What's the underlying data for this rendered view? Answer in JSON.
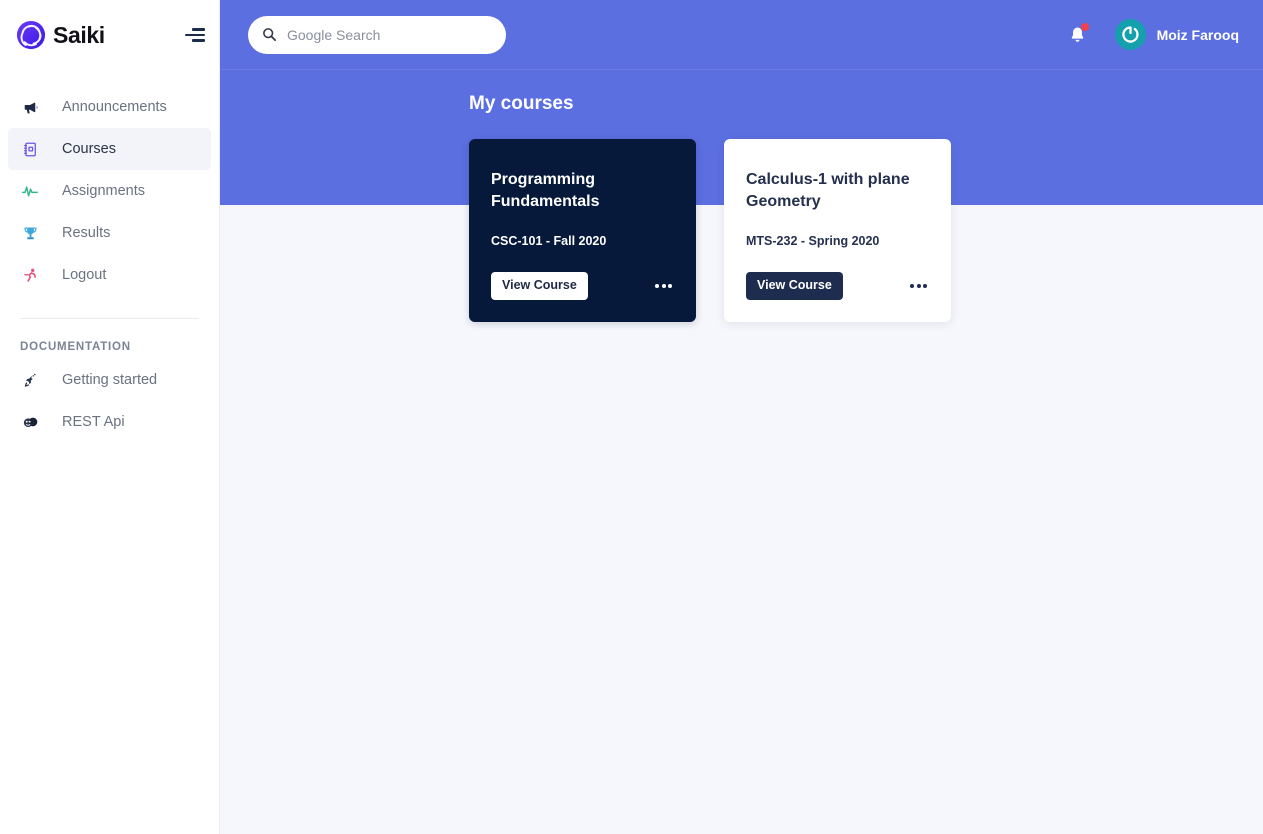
{
  "brand": {
    "name": "Saiki",
    "logo_icon": "aperture-icon",
    "logo_color": "#5522f0",
    "menu_icon": "hamburger-menu-icon"
  },
  "sidebar": {
    "items": [
      {
        "label": "Announcements",
        "icon": "megaphone-icon",
        "active": false
      },
      {
        "label": "Courses",
        "icon": "notebook-icon",
        "active": true
      },
      {
        "label": "Assignments",
        "icon": "activity-pulse-icon",
        "active": false
      },
      {
        "label": "Results",
        "icon": "trophy-icon",
        "active": false
      },
      {
        "label": "Logout",
        "icon": "running-person-icon",
        "active": false
      }
    ],
    "section_title": "DOCUMENTATION",
    "doc_items": [
      {
        "label": "Getting started",
        "icon": "rocket-icon"
      },
      {
        "label": "REST Api",
        "icon": "theater-masks-icon"
      }
    ]
  },
  "topbar": {
    "search": {
      "placeholder": "Google Search",
      "value": "",
      "icon": "search-icon"
    },
    "notifications": {
      "icon": "bell-icon",
      "has_unread": true,
      "badge_color": "#f0414d"
    },
    "user": {
      "name": "Moiz Farooq",
      "avatar_icon": "power-circle-icon",
      "avatar_color": "#15a0ad"
    },
    "accent_color": "#5c6fe0"
  },
  "main": {
    "page_title": "My courses",
    "courses": [
      {
        "title": "Programming Fundamentals",
        "meta": "CSC-101 - Fall 2020",
        "button_label": "View Course",
        "menu_icon": "more-horizontal-icon",
        "theme": "dark",
        "bg_color": "#06193a"
      },
      {
        "title": "Calculus-1 with plane Geometry",
        "meta": "MTS-232 - Spring 2020",
        "button_label": "View Course",
        "menu_icon": "more-horizontal-icon",
        "theme": "light",
        "bg_color": "#ffffff"
      }
    ]
  }
}
